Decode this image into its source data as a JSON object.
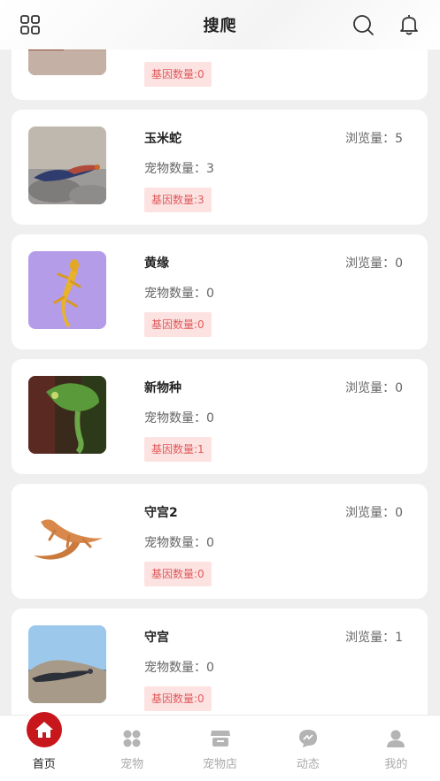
{
  "header": {
    "title": "搜爬"
  },
  "labels": {
    "views_prefix": "浏览量：",
    "count_prefix": "宠物数量：",
    "gene_prefix": "基因数量:"
  },
  "partial_card": {
    "gene_text": "基因数量:0"
  },
  "cards": [
    {
      "name": "玉米蛇",
      "views_text": "浏览量：5",
      "count_text": "宠物数量：3",
      "gene_text": "基因数量:3",
      "thumb": "lizard-on-rock"
    },
    {
      "name": "黄缘",
      "views_text": "浏览量：0",
      "count_text": "宠物数量：0",
      "gene_text": "基因数量:0",
      "thumb": "yellow-gecko-purple"
    },
    {
      "name": "新物种",
      "views_text": "浏览量：0",
      "count_text": "宠物数量：0",
      "gene_text": "基因数量:1",
      "thumb": "chameleon"
    },
    {
      "name": "守宫2",
      "views_text": "浏览量：0",
      "count_text": "宠物数量：0",
      "gene_text": "基因数量:0",
      "thumb": "orange-lizard"
    },
    {
      "name": "守宫",
      "views_text": "浏览量：1",
      "count_text": "宠物数量：0",
      "gene_text": "基因数量:0",
      "thumb": "lizard-sea-rock"
    }
  ],
  "tabbar": {
    "items": [
      {
        "label": "首页",
        "icon": "home-icon",
        "active": true
      },
      {
        "label": "宠物",
        "icon": "grid-icon",
        "active": false
      },
      {
        "label": "宠物店",
        "icon": "shop-icon",
        "active": false
      },
      {
        "label": "动态",
        "icon": "message-icon",
        "active": false
      },
      {
        "label": "我的",
        "icon": "user-icon",
        "active": false
      }
    ]
  },
  "colors": {
    "accent": "#c8161d",
    "gene_bg": "#fde2e2",
    "gene_text": "#e05a5a"
  }
}
